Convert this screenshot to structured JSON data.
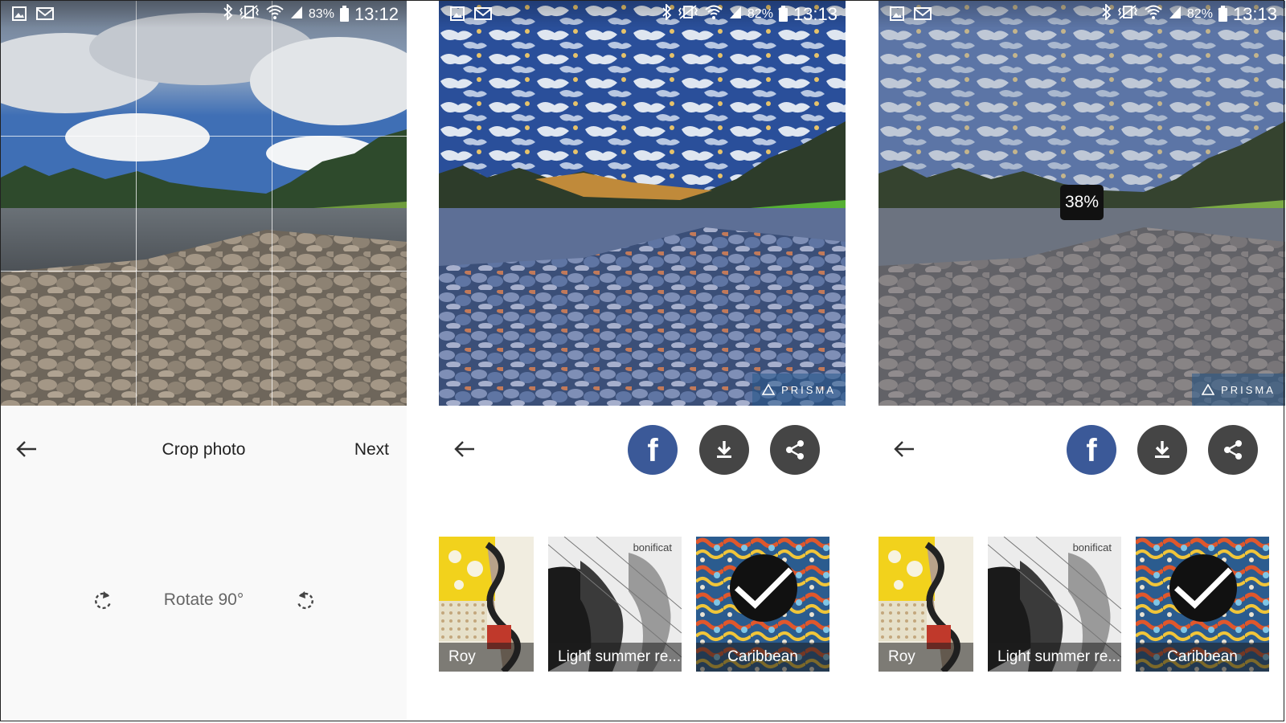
{
  "status": {
    "screen1": {
      "battery": "83%",
      "time": "13:12"
    },
    "screen2": {
      "battery": "82%",
      "time": "13:13"
    },
    "screen3": {
      "battery": "82%",
      "time": "13:13"
    }
  },
  "crop": {
    "title": "Crop photo",
    "next_label": "Next",
    "rotate_label": "Rotate 90°"
  },
  "watermark": "PRISMA",
  "progress": {
    "label": "38%",
    "value": 0.38
  },
  "filters": [
    {
      "name": "Roy",
      "selected": false
    },
    {
      "name": "Light summer re...",
      "selected": false,
      "artist": "bonificat"
    },
    {
      "name": "Caribbean",
      "selected": true
    }
  ],
  "icons": {
    "status_left": [
      "gallery-icon",
      "gmail-icon"
    ],
    "status_right": [
      "bluetooth-icon",
      "vibrate-icon",
      "wifi-icon",
      "signal-icon",
      "battery-icon"
    ],
    "actions": [
      "facebook-icon",
      "download-icon",
      "share-icon"
    ]
  },
  "colors": {
    "facebook": "#3b5998",
    "action_dark": "#454545",
    "badge": "#111111",
    "crop_bg": "#f9f9f9"
  }
}
